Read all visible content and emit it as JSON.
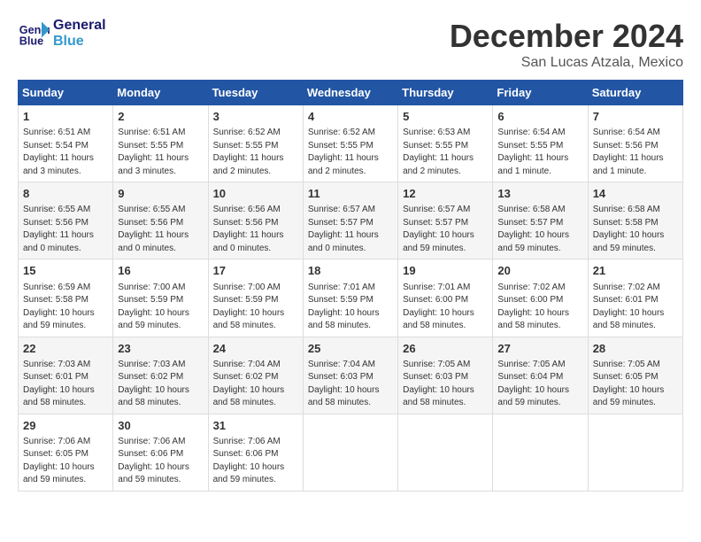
{
  "header": {
    "logo_line1": "General",
    "logo_line2": "Blue",
    "month_year": "December 2024",
    "location": "San Lucas Atzala, Mexico"
  },
  "days_of_week": [
    "Sunday",
    "Monday",
    "Tuesday",
    "Wednesday",
    "Thursday",
    "Friday",
    "Saturday"
  ],
  "weeks": [
    [
      {
        "num": "1",
        "info": "Sunrise: 6:51 AM\nSunset: 5:54 PM\nDaylight: 11 hours and 3 minutes."
      },
      {
        "num": "2",
        "info": "Sunrise: 6:51 AM\nSunset: 5:55 PM\nDaylight: 11 hours and 3 minutes."
      },
      {
        "num": "3",
        "info": "Sunrise: 6:52 AM\nSunset: 5:55 PM\nDaylight: 11 hours and 2 minutes."
      },
      {
        "num": "4",
        "info": "Sunrise: 6:52 AM\nSunset: 5:55 PM\nDaylight: 11 hours and 2 minutes."
      },
      {
        "num": "5",
        "info": "Sunrise: 6:53 AM\nSunset: 5:55 PM\nDaylight: 11 hours and 2 minutes."
      },
      {
        "num": "6",
        "info": "Sunrise: 6:54 AM\nSunset: 5:55 PM\nDaylight: 11 hours and 1 minute."
      },
      {
        "num": "7",
        "info": "Sunrise: 6:54 AM\nSunset: 5:56 PM\nDaylight: 11 hours and 1 minute."
      }
    ],
    [
      {
        "num": "8",
        "info": "Sunrise: 6:55 AM\nSunset: 5:56 PM\nDaylight: 11 hours and 0 minutes."
      },
      {
        "num": "9",
        "info": "Sunrise: 6:55 AM\nSunset: 5:56 PM\nDaylight: 11 hours and 0 minutes."
      },
      {
        "num": "10",
        "info": "Sunrise: 6:56 AM\nSunset: 5:56 PM\nDaylight: 11 hours and 0 minutes."
      },
      {
        "num": "11",
        "info": "Sunrise: 6:57 AM\nSunset: 5:57 PM\nDaylight: 11 hours and 0 minutes."
      },
      {
        "num": "12",
        "info": "Sunrise: 6:57 AM\nSunset: 5:57 PM\nDaylight: 10 hours and 59 minutes."
      },
      {
        "num": "13",
        "info": "Sunrise: 6:58 AM\nSunset: 5:57 PM\nDaylight: 10 hours and 59 minutes."
      },
      {
        "num": "14",
        "info": "Sunrise: 6:58 AM\nSunset: 5:58 PM\nDaylight: 10 hours and 59 minutes."
      }
    ],
    [
      {
        "num": "15",
        "info": "Sunrise: 6:59 AM\nSunset: 5:58 PM\nDaylight: 10 hours and 59 minutes."
      },
      {
        "num": "16",
        "info": "Sunrise: 7:00 AM\nSunset: 5:59 PM\nDaylight: 10 hours and 59 minutes."
      },
      {
        "num": "17",
        "info": "Sunrise: 7:00 AM\nSunset: 5:59 PM\nDaylight: 10 hours and 58 minutes."
      },
      {
        "num": "18",
        "info": "Sunrise: 7:01 AM\nSunset: 5:59 PM\nDaylight: 10 hours and 58 minutes."
      },
      {
        "num": "19",
        "info": "Sunrise: 7:01 AM\nSunset: 6:00 PM\nDaylight: 10 hours and 58 minutes."
      },
      {
        "num": "20",
        "info": "Sunrise: 7:02 AM\nSunset: 6:00 PM\nDaylight: 10 hours and 58 minutes."
      },
      {
        "num": "21",
        "info": "Sunrise: 7:02 AM\nSunset: 6:01 PM\nDaylight: 10 hours and 58 minutes."
      }
    ],
    [
      {
        "num": "22",
        "info": "Sunrise: 7:03 AM\nSunset: 6:01 PM\nDaylight: 10 hours and 58 minutes."
      },
      {
        "num": "23",
        "info": "Sunrise: 7:03 AM\nSunset: 6:02 PM\nDaylight: 10 hours and 58 minutes."
      },
      {
        "num": "24",
        "info": "Sunrise: 7:04 AM\nSunset: 6:02 PM\nDaylight: 10 hours and 58 minutes."
      },
      {
        "num": "25",
        "info": "Sunrise: 7:04 AM\nSunset: 6:03 PM\nDaylight: 10 hours and 58 minutes."
      },
      {
        "num": "26",
        "info": "Sunrise: 7:05 AM\nSunset: 6:03 PM\nDaylight: 10 hours and 58 minutes."
      },
      {
        "num": "27",
        "info": "Sunrise: 7:05 AM\nSunset: 6:04 PM\nDaylight: 10 hours and 59 minutes."
      },
      {
        "num": "28",
        "info": "Sunrise: 7:05 AM\nSunset: 6:05 PM\nDaylight: 10 hours and 59 minutes."
      }
    ],
    [
      {
        "num": "29",
        "info": "Sunrise: 7:06 AM\nSunset: 6:05 PM\nDaylight: 10 hours and 59 minutes."
      },
      {
        "num": "30",
        "info": "Sunrise: 7:06 AM\nSunset: 6:06 PM\nDaylight: 10 hours and 59 minutes."
      },
      {
        "num": "31",
        "info": "Sunrise: 7:06 AM\nSunset: 6:06 PM\nDaylight: 10 hours and 59 minutes."
      },
      null,
      null,
      null,
      null
    ]
  ]
}
